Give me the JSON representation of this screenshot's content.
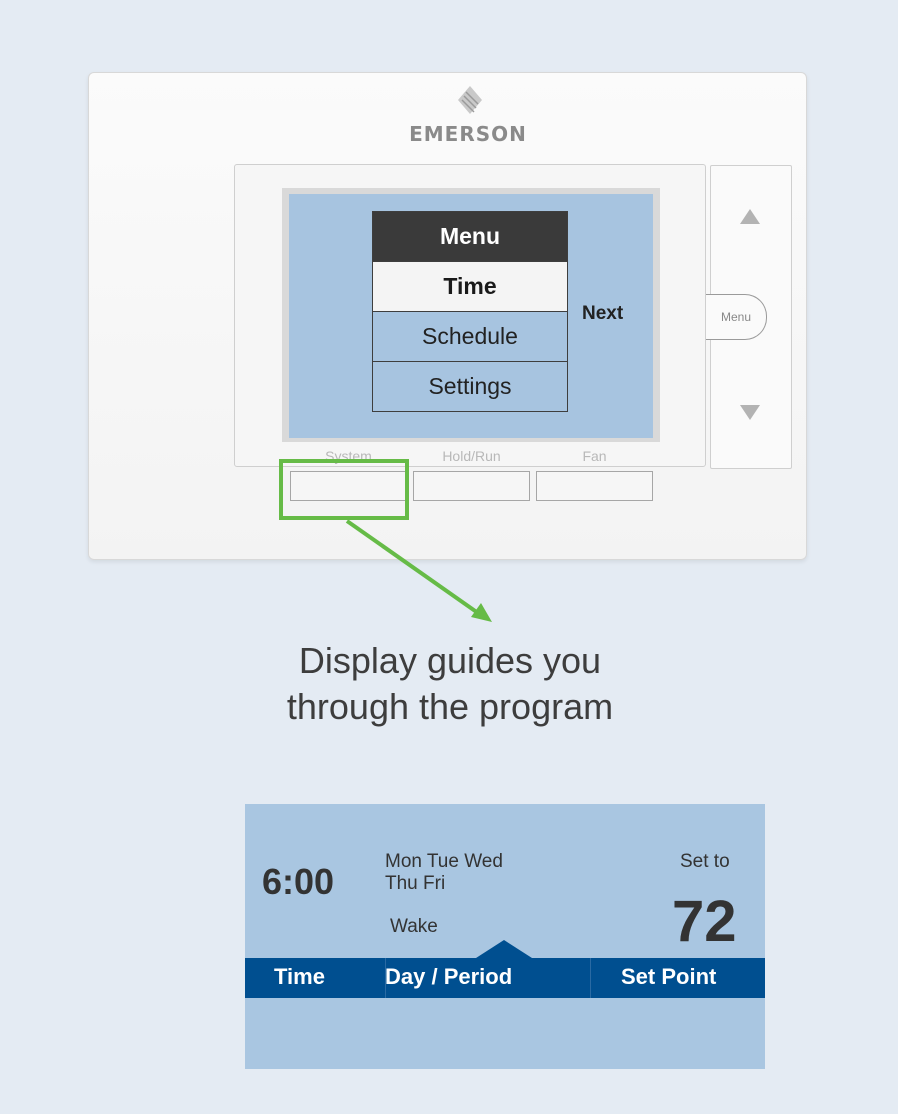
{
  "device": {
    "brand": "EMERSON",
    "menu": {
      "header": "Menu",
      "items": [
        "Time",
        "Schedule",
        "Settings"
      ]
    },
    "next_label": "Next",
    "side_buttons": {
      "menu_label": "Menu"
    },
    "bottom_buttons": [
      "System",
      "Hold/Run",
      "Fan"
    ]
  },
  "caption": {
    "line1": "Display guides you",
    "line2": "through the program"
  },
  "schedule_display": {
    "time": "6:00",
    "days_line1": "Mon Tue Wed",
    "days_line2": "Thu Fri",
    "period": "Wake",
    "set_to_label": "Set to",
    "set_point_value": "72",
    "bar_labels": [
      "Time",
      "Day / Period",
      "Set Point"
    ]
  },
  "colors": {
    "screen": "#a7c4e0",
    "highlight": "#66bb47",
    "bar": "#004f90"
  }
}
